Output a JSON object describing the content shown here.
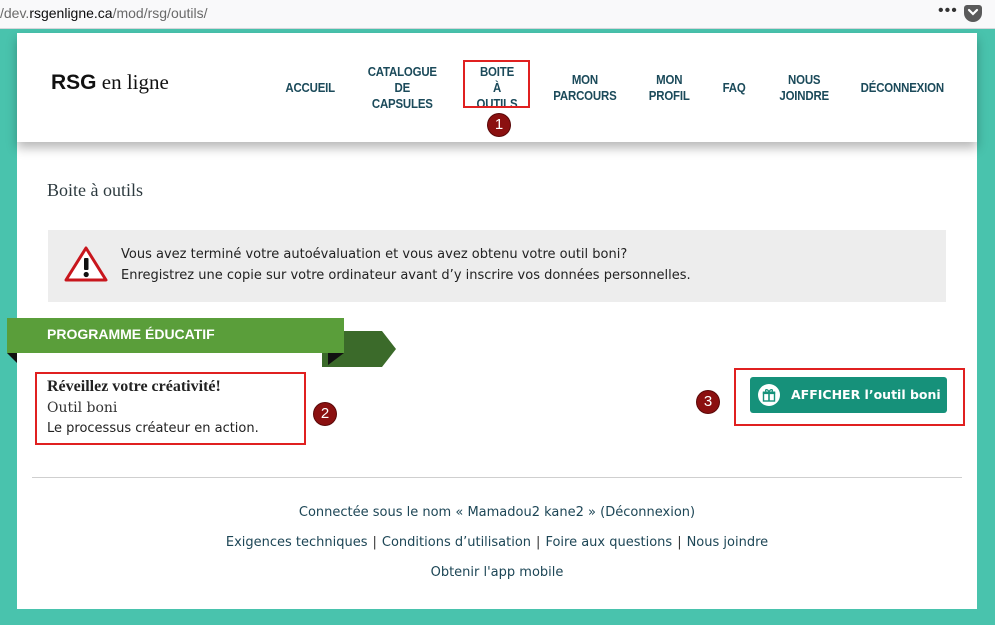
{
  "browser": {
    "url_prefix": "/dev.",
    "url_host": "rsgenligne.ca",
    "url_path": "/mod/rsg/outils/",
    "menu_dots": "•••"
  },
  "logo": {
    "bold": "RSG",
    "rest": " en ligne"
  },
  "nav": {
    "items": [
      {
        "label": "ACCUEIL"
      },
      {
        "label": "CATALOGUE\nDE CAPSULES"
      },
      {
        "label": "BOITE\nÀ OUTILS"
      },
      {
        "label": "MON\nPARCOURS"
      },
      {
        "label": "MON\nPROFIL"
      },
      {
        "label": "FAQ"
      },
      {
        "label": "NOUS\nJOINDRE"
      },
      {
        "label": "DÉCONNEXION"
      }
    ],
    "active_index": 2
  },
  "annotations": {
    "badge1": "1",
    "badge2": "2",
    "badge3": "3",
    "badge_color": "#8b1010",
    "highlight_color": "#e02020"
  },
  "page_title": "Boite à outils",
  "alert": {
    "line1": "Vous avez terminé votre autoévaluation et vous avez obtenu votre outil boni?",
    "line2": "Enregistrez une copie sur votre ordinateur avant d’y inscrire vos données personnelles.",
    "icon": "warning-triangle-icon"
  },
  "section": {
    "ribbon_label": "PROGRAMME ÉDUCATIF",
    "ribbon_color": "#5a9e3a"
  },
  "course": {
    "title": "Réveillez votre créativité!",
    "subtitle": "Outil boni",
    "description": "Le processus créateur en action."
  },
  "action_button": {
    "label": "AFFICHER l’outil boni",
    "icon": "gift-icon",
    "color": "#16917a"
  },
  "footer": {
    "logged_prefix": "Connectée sous le nom « ",
    "user_name": "Mamadou2 kane2",
    "logged_middle": " » (",
    "logout": "Déconnexion",
    "logged_suffix": ")",
    "links": [
      "Exigences techniques",
      "Conditions d’utilisation",
      "Foire aux questions",
      "Nous joindre"
    ],
    "separator": "|",
    "mobile_app": "Obtenir l'app mobile"
  }
}
